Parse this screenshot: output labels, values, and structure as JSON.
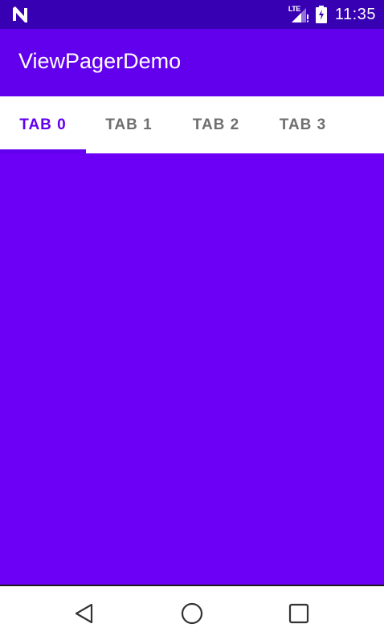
{
  "status_bar": {
    "network_label": "LTE",
    "time": "11:35",
    "icons": [
      "n-logo-icon",
      "signal-icon",
      "battery-charging-icon"
    ]
  },
  "app_bar": {
    "title": "ViewPagerDemo"
  },
  "tabs": {
    "items": [
      {
        "label": "TAB 0",
        "selected": true
      },
      {
        "label": "TAB 1",
        "selected": false
      },
      {
        "label": "TAB 2",
        "selected": false
      },
      {
        "label": "TAB 3",
        "selected": false
      }
    ]
  },
  "colors": {
    "status_bar": "#3700b3",
    "primary": "#6200ee",
    "content": "#6c00f6",
    "tab_inactive_text": "#6f6f6f"
  },
  "nav_bar": {
    "icons": [
      "back-icon",
      "home-icon",
      "recents-icon"
    ]
  }
}
